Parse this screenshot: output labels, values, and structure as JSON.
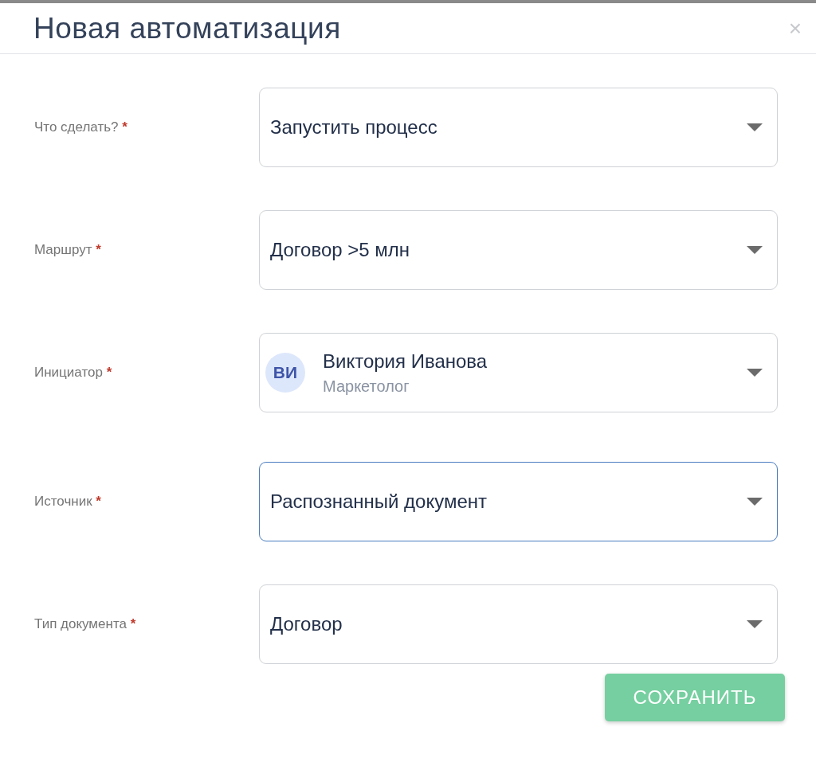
{
  "dialog": {
    "title": "Новая автоматизация",
    "close": "×"
  },
  "fields": [
    {
      "label": "Что сделать?",
      "required_mark": "*",
      "kind": "text",
      "value": "Запустить процесс",
      "focused": false
    },
    {
      "label": "Маршрут",
      "required_mark": "*",
      "kind": "text",
      "value": "Договор >5 млн",
      "focused": false
    },
    {
      "label": "Инициатор",
      "required_mark": "*",
      "kind": "person",
      "initials": "ВИ",
      "value": "Виктория Иванова",
      "subtitle": "Маркетолог",
      "focused": false
    },
    {
      "label": "Источник",
      "required_mark": "*",
      "kind": "text",
      "value": "Распознанный документ",
      "focused": true
    },
    {
      "label": "Тип документа",
      "required_mark": "*",
      "kind": "text",
      "value": "Договор",
      "focused": false
    }
  ],
  "buttons": [
    {
      "label": "СОХРАНИТЬ"
    }
  ]
}
